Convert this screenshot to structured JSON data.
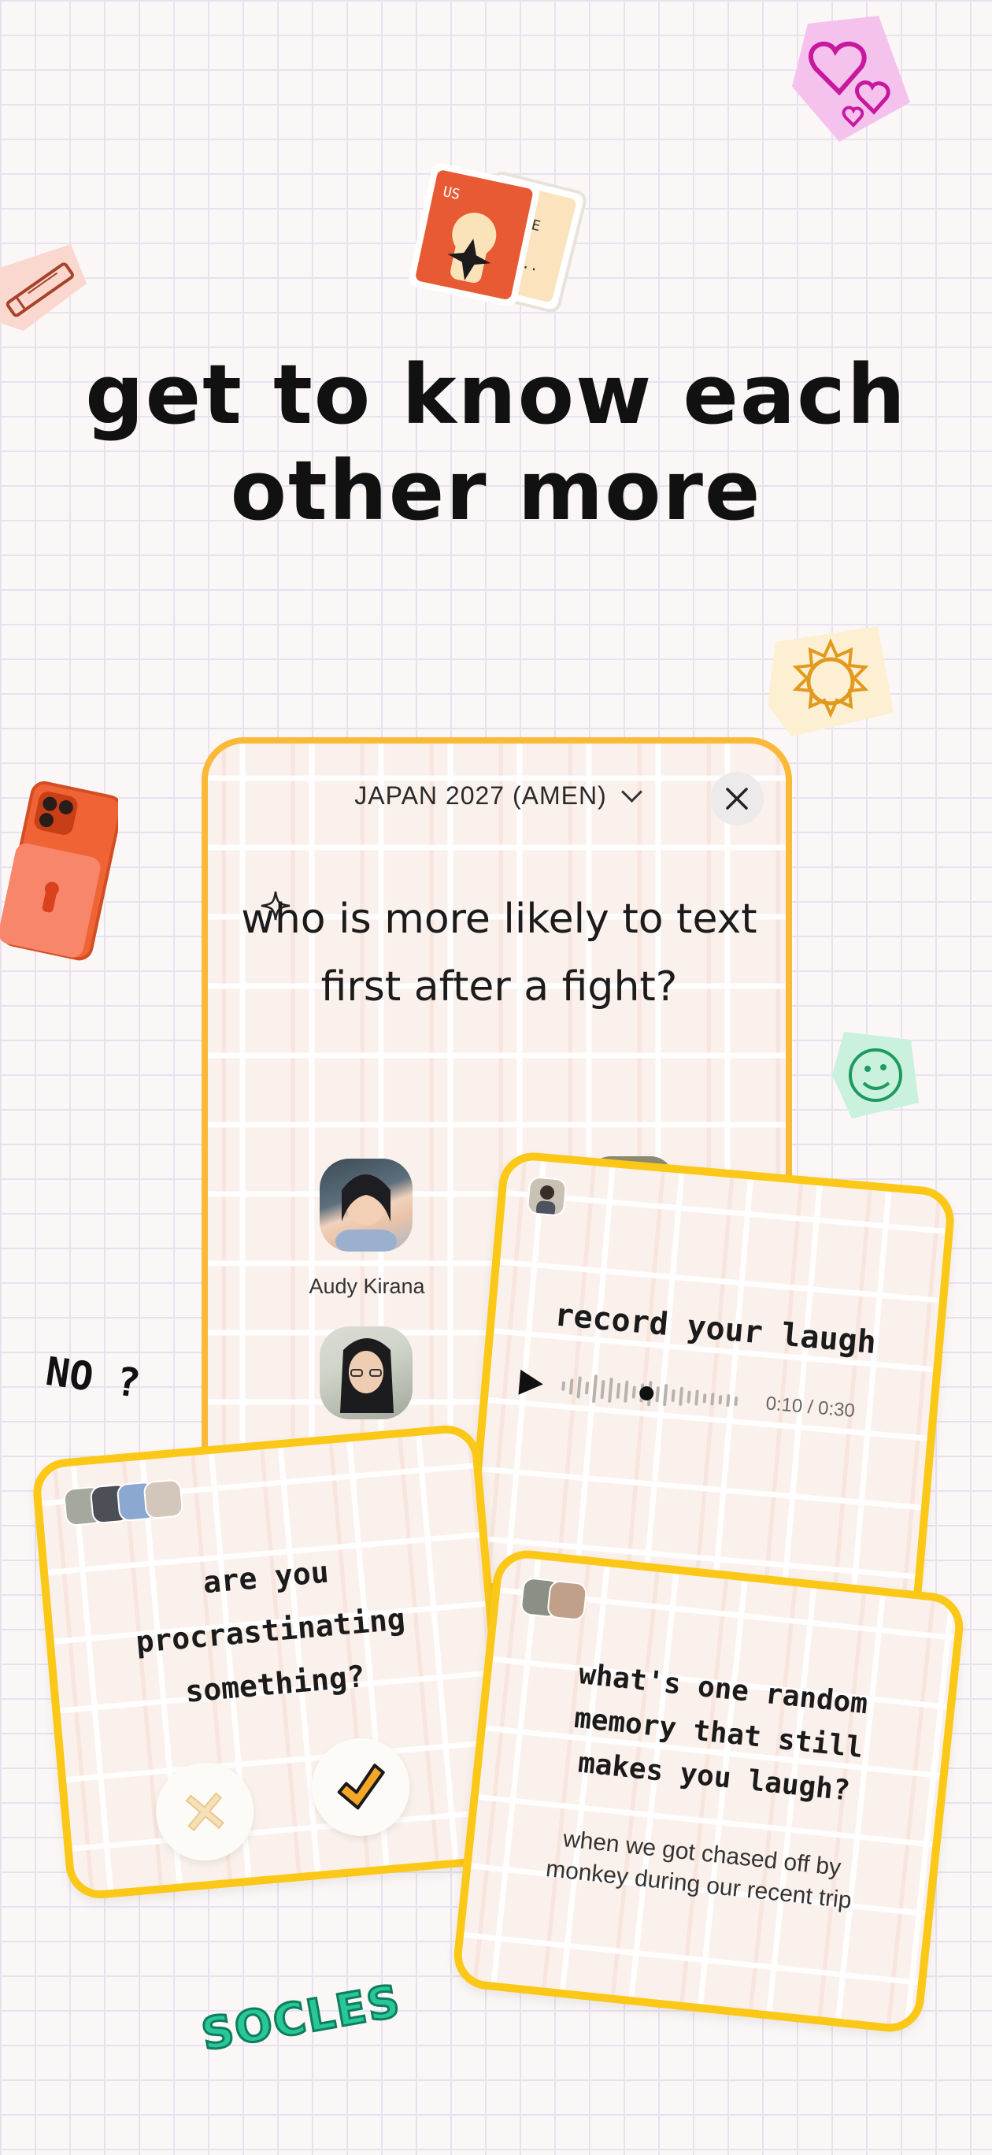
{
  "headline": {
    "line1": "get to know each",
    "line2": "other more"
  },
  "main_card": {
    "group_name": "JAPAN 2027 (AMEN)",
    "question": "who is more likely to text first after a fight?",
    "people": [
      {
        "name": "Audy Kirana"
      },
      {
        "name": ""
      }
    ]
  },
  "laugh_card": {
    "prompt": "record your laugh",
    "time": "0:10 / 0:30"
  },
  "procrastinate_card": {
    "question": "are you procrastinating something?"
  },
  "memory_card": {
    "question": "what's one random memory that still makes you laugh?",
    "answer": "when we got chased off by monkey during our recent trip"
  },
  "stickers": {
    "no_text": "NO ?",
    "brand": "SOCLES",
    "photo_sticker_text": "US"
  },
  "colors": {
    "main_border": "#fbb93a",
    "card_border": "#fbc817",
    "check": "#f4a726",
    "brand_green": "#27c79a"
  },
  "icons": [
    "chevron-down-icon",
    "close-icon",
    "sparkle-icon",
    "play-icon",
    "x-icon",
    "check-icon"
  ]
}
